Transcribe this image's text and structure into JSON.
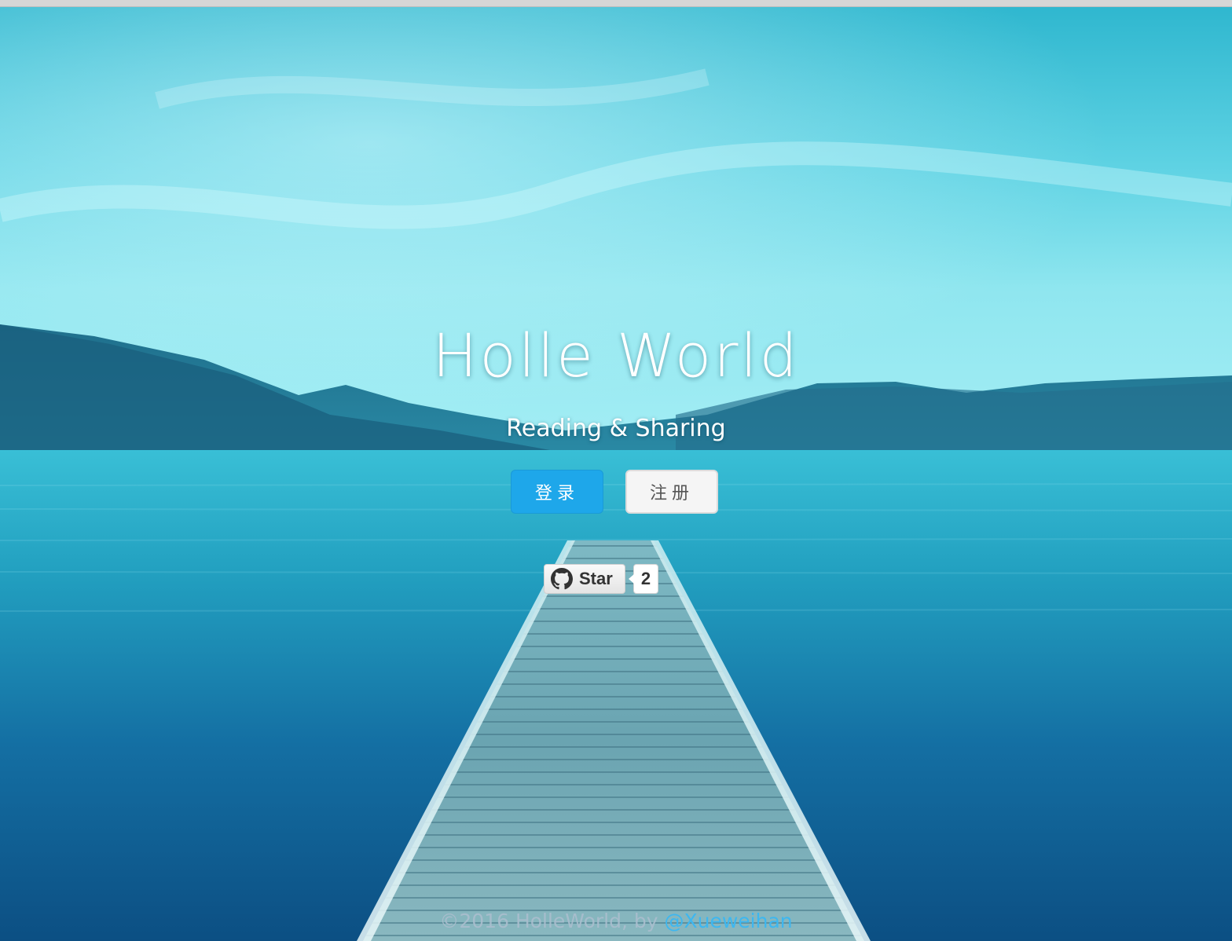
{
  "hero": {
    "title": "Holle World",
    "subtitle": "Reading & Sharing"
  },
  "actions": {
    "login_label": "登录",
    "register_label": "注册"
  },
  "github": {
    "star_label": "Star",
    "star_count": "2",
    "icon": "github-icon"
  },
  "footer": {
    "copyright": "©2016 HolleWorld, by ",
    "author_link": "@Xueweihan"
  },
  "colors": {
    "login_button": "#1ea7ea",
    "register_button": "#f5f5f5",
    "footer_link": "#3db7f0",
    "sky": "#7fe0ec",
    "water": "#0e5f92"
  }
}
